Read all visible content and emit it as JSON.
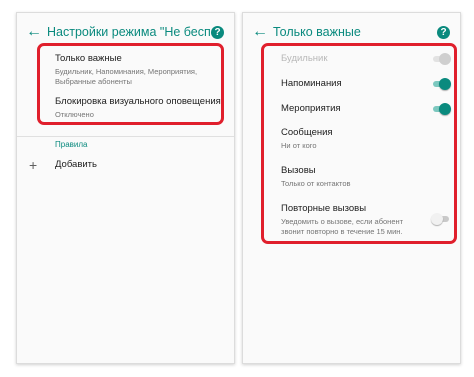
{
  "left_screen": {
    "title": "Настройки режима \"Не бесп…",
    "items": [
      {
        "primary": "Только важные",
        "secondary": "Будильник, Напоминания, Мероприятия, Выбранные абоненты"
      },
      {
        "primary": "Блокировка визуального оповещения",
        "secondary": "Отключено"
      }
    ],
    "section_header": "Правила",
    "add_label": "Добавить",
    "add_symbol": "+"
  },
  "right_screen": {
    "title": "Только важные",
    "items": [
      {
        "primary": "Будильник",
        "toggle": "on",
        "enabled": false
      },
      {
        "primary": "Напоминания",
        "toggle": "on",
        "enabled": true
      },
      {
        "primary": "Мероприятия",
        "toggle": "on",
        "enabled": true
      },
      {
        "primary": "Сообщения",
        "secondary": "Ни от кого"
      },
      {
        "primary": "Вызовы",
        "secondary": "Только от контактов"
      },
      {
        "primary": "Повторные вызовы",
        "secondary": "Уведомить о вызове, если абонент звонит повторно в течение 15 мин.",
        "toggle": "off",
        "enabled": true
      }
    ]
  },
  "icons": {
    "back": "←",
    "help": "?"
  },
  "colors": {
    "accent": "#0a8a7e",
    "highlight": "#e01f2c",
    "toggle_track_on": "#7cc8bf"
  }
}
